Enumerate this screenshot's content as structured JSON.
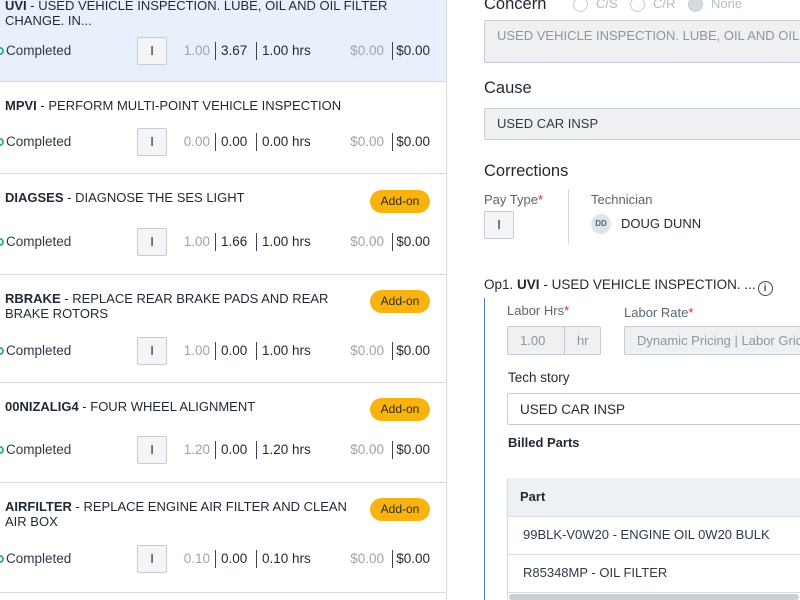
{
  "ops": [
    {
      "code": "UVI",
      "desc": "USED VEHICLE INSPECTION. LUBE, OIL AND OIL FILTER CHANGE. IN...",
      "addon": "",
      "status": "Completed",
      "pay": "I",
      "v1": "1.00",
      "v2": "3.67",
      "v3": "1.00 hrs",
      "v4": "$0.00",
      "v5": "$0.00"
    },
    {
      "code": "MPVI",
      "desc": "PERFORM MULTI-POINT VEHICLE INSPECTION",
      "addon": "",
      "status": "Completed",
      "pay": "I",
      "v1": "0.00",
      "v2": "0.00",
      "v3": "0.00 hrs",
      "v4": "$0.00",
      "v5": "$0.00"
    },
    {
      "code": "DIAGSES",
      "desc": "DIAGNOSE THE SES LIGHT",
      "addon": "Add-on",
      "status": "Completed",
      "pay": "I",
      "v1": "1.00",
      "v2": "1.66",
      "v3": "1.00 hrs",
      "v4": "$0.00",
      "v5": "$0.00"
    },
    {
      "code": "RBRAKE",
      "desc": "REPLACE REAR BRAKE PADS AND REAR BRAKE ROTORS",
      "addon": "Add-on",
      "status": "Completed",
      "pay": "I",
      "v1": "1.00",
      "v2": "0.00",
      "v3": "1.00 hrs",
      "v4": "$0.00",
      "v5": "$0.00"
    },
    {
      "code": "00NIZALIG4",
      "desc": "FOUR WHEEL ALIGNMENT",
      "addon": "Add-on",
      "status": "Completed",
      "pay": "I",
      "v1": "1.20",
      "v2": "0.00",
      "v3": "1.20 hrs",
      "v4": "$0.00",
      "v5": "$0.00"
    },
    {
      "code": "AIRFILTER",
      "desc": "REPLACE ENGINE AIR FILTER AND CLEAN AIR BOX",
      "addon": "Add-on",
      "status": "Completed",
      "pay": "I",
      "v1": "0.10",
      "v2": "0.00",
      "v3": "0.10 hrs",
      "v4": "$0.00",
      "v5": "$0.00"
    }
  ],
  "detail": {
    "concern_label": "Concern",
    "radio_cs": "C/S",
    "radio_cr": "C/R",
    "radio_none": "None",
    "concern_value": "USED VEHICLE INSPECTION. LUBE, OIL AND OIL FILTER",
    "cause_label": "Cause",
    "cause_value": "USED CAR INSP",
    "corrections_label": "Corrections",
    "pay_type_label": "Pay Type",
    "pay_type_value": "I",
    "technician_label": "Technician",
    "tech_initials": "DD",
    "tech_name": "DOUG DUNN",
    "op_prefix": "Op1.",
    "op_code": "UVI",
    "op_desc": "- USED VEHICLE INSPECTION. ...",
    "labor_hrs_label": "Labor Hrs",
    "labor_hrs_value": "1.00",
    "labor_hrs_unit": "hr",
    "labor_rate_label": "Labor Rate",
    "labor_rate_value": "Dynamic Pricing | Labor Grid",
    "tech_story_label": "Tech story",
    "tech_story_value": "USED CAR INSP",
    "billed_parts_label": "Billed Parts",
    "parts_header": "Part",
    "parts": [
      "99BLK-V0W20 - ENGINE OIL 0W20 BULK",
      "R85348MP - OIL FILTER"
    ]
  }
}
